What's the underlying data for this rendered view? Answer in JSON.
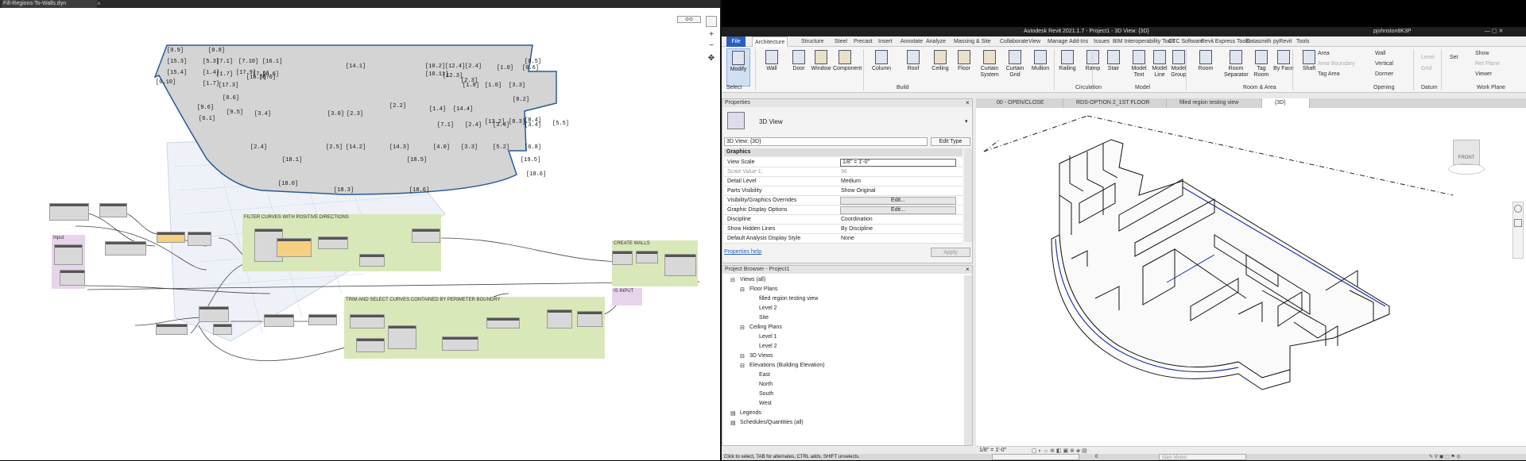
{
  "dynamo": {
    "file_tab": "Fill-Regions-To-Walls.dyn",
    "close_glyph": "×",
    "region_labels": [
      "[0.9]",
      "[0.8]",
      "[15.3]",
      "[5.3]",
      "[7.1]",
      "[7.10]",
      "[16.1]",
      "[10.2]",
      "[12.4]",
      "[2.4]",
      "[1.0]",
      "[0.5]",
      "[15.4]",
      "[1.4]",
      "[1.7]",
      "[17.9]",
      "[7.5]",
      "[6.6]",
      "[14.1]",
      "[10.11]",
      "[12.3]",
      "[0.6]",
      "[0.10]",
      "[1.7]",
      "[17.3]",
      "[16.5]",
      "[6.0]",
      "[2.3]",
      "[1.8]",
      "[1.0]",
      "[3.3]",
      "[8.2]",
      "[8.6]",
      "[9.6]",
      "[9.5]",
      "[3.4]",
      "[3.0]",
      "[2.3]",
      "[2.2]",
      "[1.4]",
      "[14.4]",
      "[13.2]",
      "[8.3]",
      "[8.4]",
      "[5.5]",
      "[6.1]",
      "[7.1]",
      "[2.4]",
      "[3.4]",
      "[3.4]",
      "[2.4]",
      "[2.5]",
      "[14.2]",
      "[14.3]",
      "[4.0]",
      "[3.3]",
      "[5.2]",
      "[6.8]",
      "[18.1]",
      "[18.5]",
      "[19.5]",
      "[18.6]",
      "[18.0]",
      "[18.3]",
      "[18.6]"
    ],
    "groups": {
      "input": "Input",
      "filter": "FILTER CURVES WITH POSITIVE DIRECTIONS",
      "create_walls": "CREATE WALLS",
      "is_input": "IS INPUT",
      "trim": "TRIM AND SELECT CURVES CONTAINED BY PERIMETER BOUNDRY"
    }
  },
  "revit": {
    "title": "Autodesk Revit 2021.1.7 - Project1 - 3D View: {3D}",
    "user": "pjohnston8K3P",
    "menu": {
      "file": "File",
      "tabs": [
        "Architecture",
        "Structure",
        "Steel",
        "Precast",
        "Insert",
        "Annotate",
        "Analyze",
        "Massing & Site",
        "Collaborate",
        "View",
        "Manage",
        "Add-Ins",
        "Issues",
        "BIM Interoperability Tools",
        "CTC Software",
        "Revit Express Tools",
        "Datasmith",
        "pyRevit",
        "Tools"
      ]
    },
    "ribbon": {
      "modify": "Modify",
      "select": "Select",
      "build_buttons": [
        "Wall",
        "Door",
        "Window",
        "Component",
        "Column",
        "Roof",
        "Ceiling",
        "Floor",
        "Curtain System",
        "Curtain Grid",
        "Mullion"
      ],
      "circulation_buttons": [
        "Railing",
        "Ramp",
        "Stair"
      ],
      "model_buttons": [
        "Model Text",
        "Model Line",
        "Model Group"
      ],
      "room_buttons": [
        "Room",
        "Room Separator",
        "Tag Room"
      ],
      "room_small": [
        "Area",
        "Area Boundary",
        "Tag Area"
      ],
      "opening_buttons": [
        "By Face",
        "Shaft"
      ],
      "opening_small": [
        "Wall",
        "Vertical",
        "Dormer"
      ],
      "datum_small": [
        "Level",
        "Grid"
      ],
      "workplane_small": [
        "Set",
        "Show",
        "Ref Plane",
        "Viewer"
      ],
      "panels": [
        "Build",
        "Circulation",
        "Model",
        "Room & Area",
        "Opening",
        "Datum",
        "Work Plane"
      ]
    },
    "properties": {
      "title": "Properties",
      "type_name": "3D View",
      "selector": "3D View: {3D}",
      "edit_type": "Edit Type",
      "section": "Graphics",
      "rows": [
        {
          "k": "View Scale",
          "v": "1/8\" = 1'-0\""
        },
        {
          "k": "Scale Value    1:",
          "v": "96"
        },
        {
          "k": "Detail Level",
          "v": "Medium"
        },
        {
          "k": "Parts Visibility",
          "v": "Show Original"
        },
        {
          "k": "Visibility/Graphics Overrides",
          "v": "Edit..."
        },
        {
          "k": "Graphic Display Options",
          "v": "Edit..."
        },
        {
          "k": "Discipline",
          "v": "Coordination"
        },
        {
          "k": "Show Hidden Lines",
          "v": "By Discipline"
        },
        {
          "k": "Default Analysis Display Style",
          "v": "None"
        }
      ],
      "help": "Properties help",
      "apply": "Apply"
    },
    "browser": {
      "title": "Project Browser - Project1",
      "items": [
        {
          "t": "Views (all)",
          "lvl": 0
        },
        {
          "t": "Floor Plans",
          "lvl": 1
        },
        {
          "t": "filled region testing view",
          "lvl": 2
        },
        {
          "t": "Level 2",
          "lvl": 2
        },
        {
          "t": "Site",
          "lvl": 2
        },
        {
          "t": "Ceiling Plans",
          "lvl": 1
        },
        {
          "t": "Level 1",
          "lvl": 2
        },
        {
          "t": "Level 2",
          "lvl": 2
        },
        {
          "t": "3D Views",
          "lvl": 1
        },
        {
          "t": "Elevations (Building Elevation)",
          "lvl": 1
        },
        {
          "t": "East",
          "lvl": 2
        },
        {
          "t": "North",
          "lvl": 2
        },
        {
          "t": "South",
          "lvl": 2
        },
        {
          "t": "West",
          "lvl": 2
        },
        {
          "t": "Legends",
          "lvl": 0
        },
        {
          "t": "Schedules/Quantities (all)",
          "lvl": 0
        }
      ]
    },
    "view_tabs": [
      "00 - OPEN/CLOSE",
      "RDS-OPTION 2_1ST FLOOR",
      "filled region testing view",
      "{3D}"
    ],
    "viewcube": "FRONT",
    "view_scale": "1/8\" = 1'-0\"",
    "status": "Click to select, TAB for alternates, CTRL adds, SHIFT unselects.",
    "status_zero": "0",
    "main_model": "Main Model"
  }
}
